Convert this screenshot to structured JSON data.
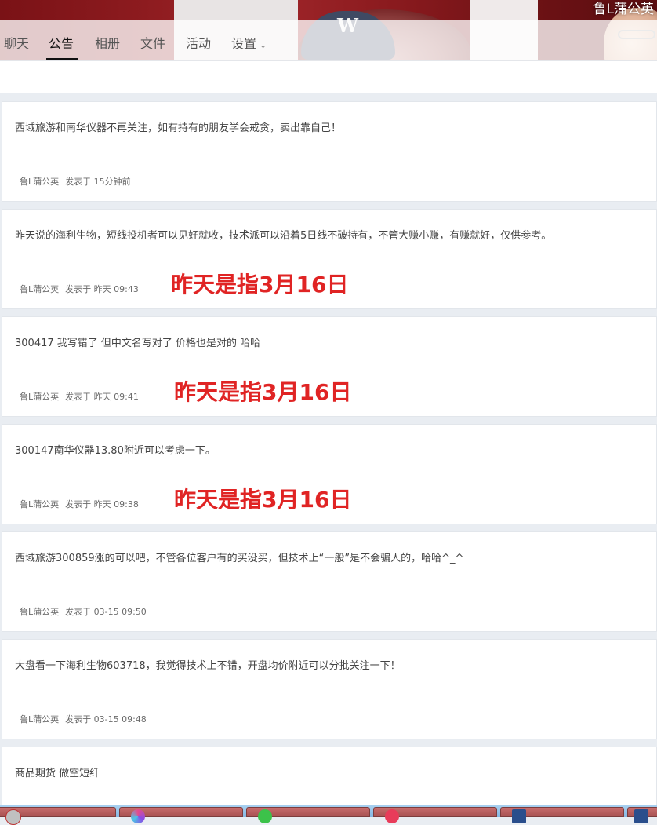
{
  "header": {
    "username": "鲁L蒲公英",
    "tabs": [
      {
        "label": "聊天"
      },
      {
        "label": "公告"
      },
      {
        "label": "相册"
      },
      {
        "label": "文件"
      },
      {
        "label": "活动"
      },
      {
        "label": "设置"
      }
    ],
    "active_tab": "公告",
    "banner_cap_letter": "W"
  },
  "posts": [
    {
      "content": "西域旅游和南华仪器不再关注，如有持有的朋友学会戒贪，卖出靠自己！",
      "author": "鲁L蒲公英",
      "posted": "发表于 15分钟前"
    },
    {
      "content": "昨天说的海利生物，短线投机者可以见好就收，技术派可以沿着5日线不破持有，不管大赚小赚，有赚就好，仅供参考。",
      "author": "鲁L蒲公英",
      "posted": "发表于 昨天 09:43",
      "note": "昨天是指3月16日"
    },
    {
      "content": "300417 我写错了 但中文名写对了 价格也是对的 哈哈",
      "author": "鲁L蒲公英",
      "posted": "发表于 昨天 09:41",
      "note": "昨天是指3月16日"
    },
    {
      "content": "300147南华仪器13.80附近可以考虑一下。",
      "author": "鲁L蒲公英",
      "posted": "发表于 昨天 09:38",
      "note": "昨天是指3月16日"
    },
    {
      "content": "西域旅游300859涨的可以吧，不管各位客户有的买没买，但技术上“一般”是不会骗人的，哈哈^_^",
      "author": "鲁L蒲公英",
      "posted": "发表于 03-15 09:50"
    },
    {
      "content": "大盘看一下海利生物603718，我觉得技术上不错，开盘均价附近可以分批关注一下！",
      "author": "鲁L蒲公英",
      "posted": "发表于 03-15 09:48"
    },
    {
      "content": "商品期货 做空短纤"
    }
  ],
  "colors": {
    "note_red": "#e02424",
    "banner_red": "#8d1b1f",
    "page_bg": "#e9edf2"
  }
}
